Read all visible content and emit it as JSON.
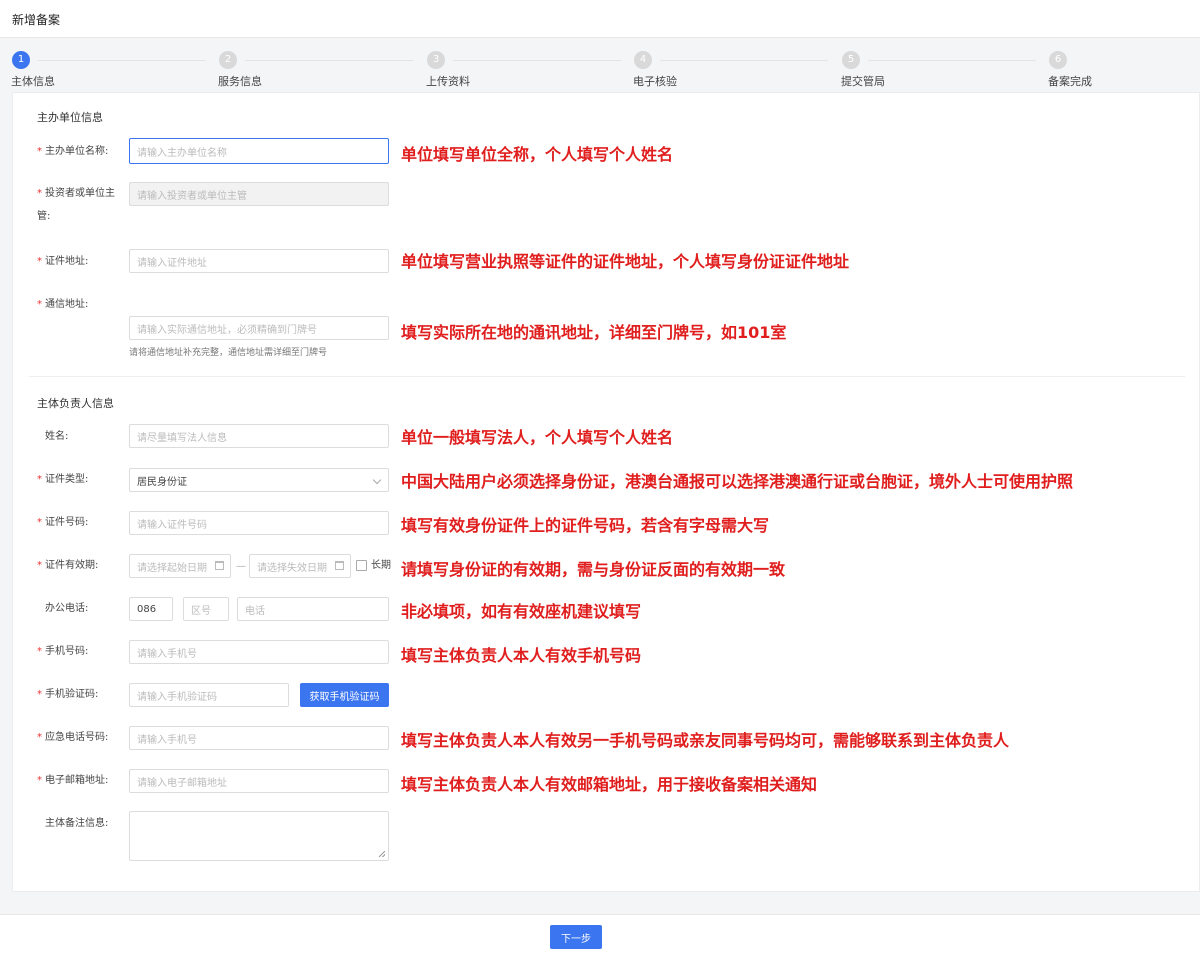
{
  "page_title": "新增备案",
  "steps": [
    {
      "num": "1",
      "label": "主体信息"
    },
    {
      "num": "2",
      "label": "服务信息"
    },
    {
      "num": "3",
      "label": "上传资料"
    },
    {
      "num": "4",
      "label": "电子核验"
    },
    {
      "num": "5",
      "label": "提交管局"
    },
    {
      "num": "6",
      "label": "备案完成"
    }
  ],
  "section1": {
    "title": "主办单位信息",
    "org_name": {
      "label": "主办单位名称:",
      "placeholder": "请输入主办单位名称",
      "note": "单位填写单位全称，个人填写个人姓名"
    },
    "investor": {
      "label1": "投资者或单位主",
      "label2": "管:",
      "placeholder": "请输入投资者或单位主管"
    },
    "cert_addr": {
      "label": "证件地址:",
      "placeholder": "请输入证件地址",
      "note": "单位填写营业执照等证件的证件地址，个人填写身份证证件地址"
    },
    "mail_addr": {
      "label": "通信地址:",
      "placeholder": "请输入实际通信地址，必须精确到门牌号",
      "hint": "请将通信地址补充完整，通信地址需详细至门牌号",
      "note": "填写实际所在地的通讯地址，详细至门牌号，如101室"
    }
  },
  "section2": {
    "title": "主体负责人信息",
    "name": {
      "label": "姓名:",
      "placeholder": "请尽量填写法人信息",
      "note": "单位一般填写法人，个人填写个人姓名"
    },
    "cert_type": {
      "label": "证件类型:",
      "value": "居民身份证",
      "note": "中国大陆用户必须选择身份证，港澳台通报可以选择港澳通行证或台胞证，境外人士可使用护照"
    },
    "cert_no": {
      "label": "证件号码:",
      "placeholder": "请输入证件号码",
      "note": "填写有效身份证件上的证件号码，若含有字母需大写"
    },
    "cert_valid": {
      "label": "证件有效期:",
      "start_placeholder": "请选择起始日期",
      "sep": "—",
      "end_placeholder": "请选择失效日期",
      "long_term": "长期",
      "note": "请填写身份证的有效期，需与身份证反面的有效期一致"
    },
    "office_phone": {
      "label": "办公电话:",
      "country": "086",
      "area_placeholder": "区号",
      "phone_placeholder": "电话",
      "note": "非必填项，如有有效座机建议填写"
    },
    "mobile": {
      "label": "手机号码:",
      "placeholder": "请输入手机号",
      "note": "填写主体负责人本人有效手机号码"
    },
    "sms_code": {
      "label": "手机验证码:",
      "placeholder": "请输入手机验证码",
      "button": "获取手机验证码"
    },
    "emergency": {
      "label": "应急电话号码:",
      "placeholder": "请输入手机号",
      "note": "填写主体负责人本人有效另一手机号码或亲友同事号码均可，需能够联系到主体负责人"
    },
    "email": {
      "label": "电子邮箱地址:",
      "placeholder": "请输入电子邮箱地址",
      "note": "填写主体负责人本人有效邮箱地址，用于接收备案相关通知"
    },
    "remark": {
      "label": "主体备注信息:"
    }
  },
  "next_button": "下一步",
  "colors": {
    "primary": "#3b75f0",
    "note_red": "#e01e1e",
    "required_red": "#e33"
  }
}
